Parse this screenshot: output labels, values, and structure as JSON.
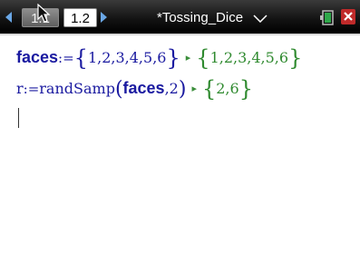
{
  "window": {
    "title": "*Tossing_Dice",
    "tabs": [
      {
        "label": "1.1",
        "active": false
      },
      {
        "label": "1.2",
        "active": true
      }
    ]
  },
  "icons": {
    "nav_prev": "left-arrow-icon",
    "nav_next": "right-arrow-icon",
    "dropdown": "chevron-down-icon",
    "battery": "battery-icon",
    "close": "close-icon",
    "pointer": "mouse-pointer-icon",
    "result_arrow": "result-arrow-icon"
  },
  "colors": {
    "topbar": "#141414",
    "nav_arrow": "#6aa7e6",
    "input_text": "#1a1aa0",
    "result_text": "#2f8a2f",
    "close": "#c02a2a",
    "battery": "#2fa84a"
  },
  "calculator": {
    "entries": [
      {
        "variable": "faces",
        "operator": ":=",
        "input_values": "1,2,3,4,5,6",
        "result_values": "1,2,3,4,5,6"
      },
      {
        "variable": "r",
        "operator": ":=",
        "function": "randSamp",
        "argument": "faces",
        "argument_extra": ",2",
        "result_values": "2,6"
      }
    ]
  }
}
